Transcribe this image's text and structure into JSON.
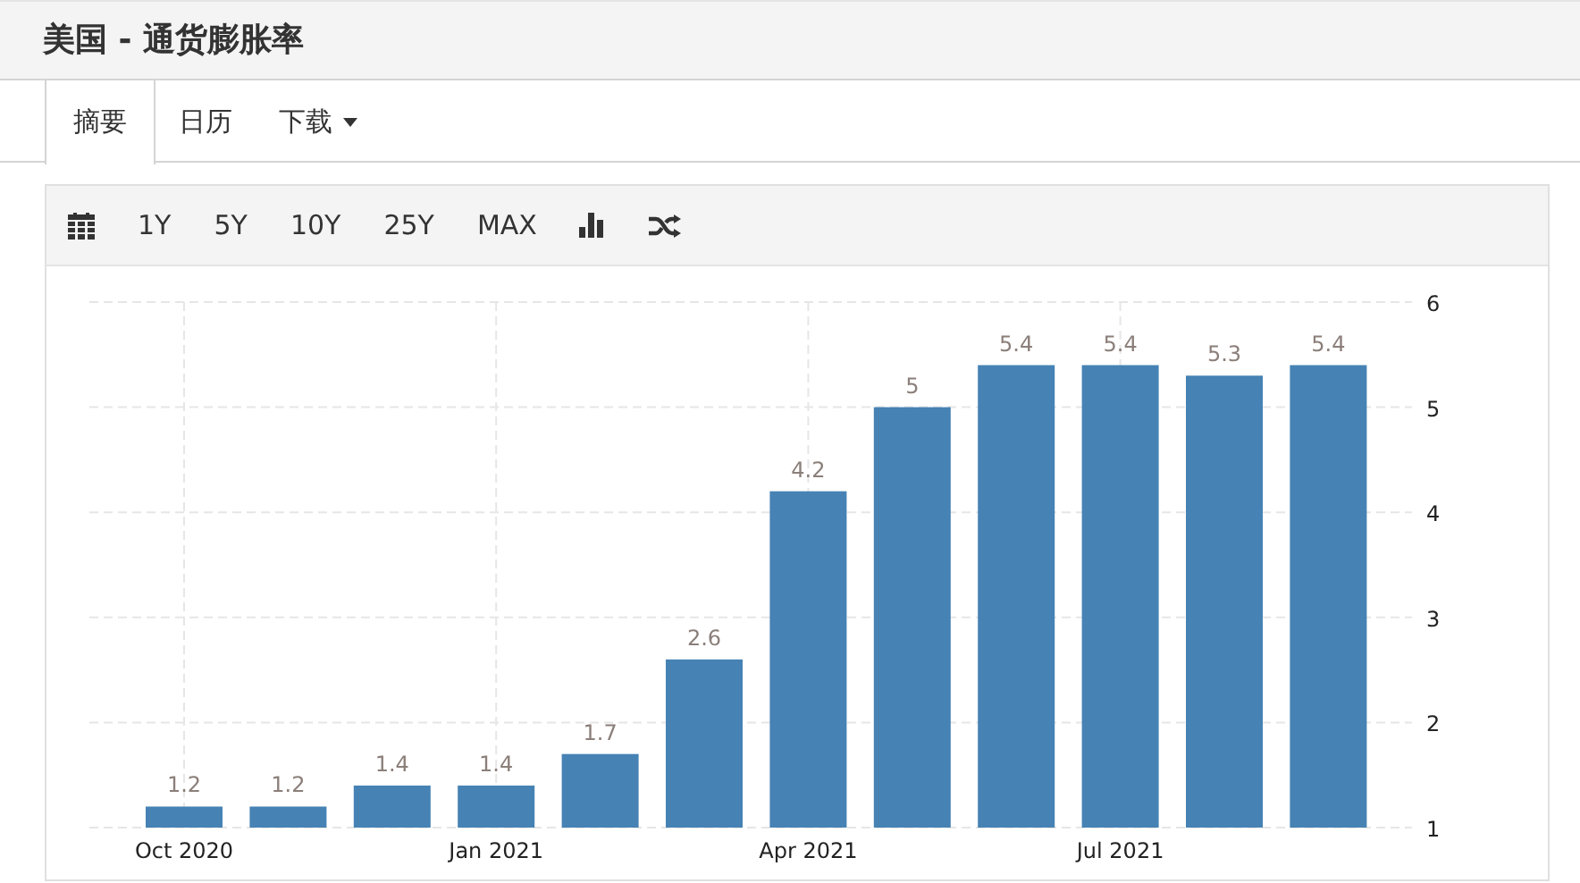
{
  "header": {
    "title": "美国 - 通货膨胀率"
  },
  "tabs": [
    {
      "label": "摘要",
      "selected": true,
      "dropdown": false
    },
    {
      "label": "日历",
      "selected": false,
      "dropdown": false
    },
    {
      "label": "下载",
      "selected": false,
      "dropdown": true
    }
  ],
  "toolbar": {
    "items": [
      {
        "kind": "calendar"
      },
      {
        "kind": "text",
        "label": "1Y"
      },
      {
        "kind": "text",
        "label": "5Y"
      },
      {
        "kind": "text",
        "label": "10Y"
      },
      {
        "kind": "text",
        "label": "25Y"
      },
      {
        "kind": "text",
        "label": "MAX"
      },
      {
        "kind": "bars"
      },
      {
        "kind": "shuffle"
      }
    ]
  },
  "chart": {
    "chart_data": {
      "type": "bar",
      "categories": [
        "Oct 2020",
        null,
        null,
        "Jan 2021",
        null,
        null,
        "Apr 2021",
        null,
        null,
        "Jul 2021",
        null,
        null
      ],
      "series": [
        {
          "color": "#4682b4",
          "values": [
            1.2,
            1.2,
            1.4,
            1.4,
            1.7,
            2.6,
            4.2,
            5,
            5.4,
            5.4,
            5.3,
            5.4
          ]
        }
      ],
      "value_labels": [
        "1.2",
        "1.2",
        "1.4",
        "1.4",
        "1.7",
        "2.6",
        "4.2",
        "5",
        "5.4",
        "5.4",
        "5.3",
        "5.4"
      ],
      "grid": true,
      "ylim": [
        1,
        6
      ],
      "yticks": [
        {
          "value": 1,
          "label": "1"
        },
        {
          "value": 2,
          "label": "2"
        },
        {
          "value": 3,
          "label": "3"
        },
        {
          "value": 4,
          "label": "4"
        },
        {
          "value": 5,
          "label": "5"
        },
        {
          "value": 6,
          "label": "6"
        }
      ]
    }
  }
}
